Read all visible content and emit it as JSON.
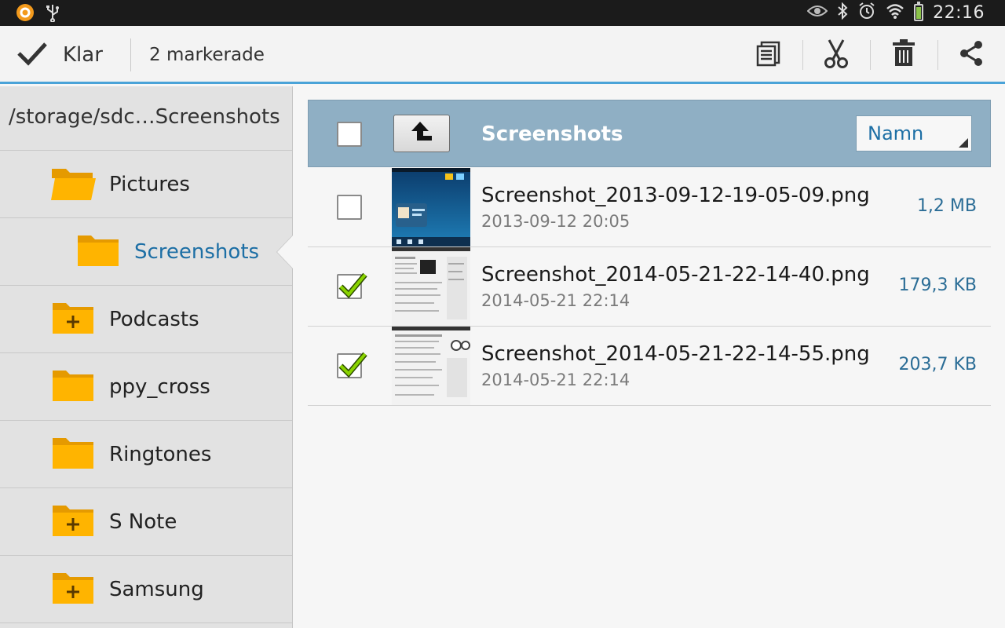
{
  "status_bar": {
    "time": "22:16"
  },
  "action_bar": {
    "done_label": "Klar",
    "selected_count": "2 markerade",
    "actions": [
      "select-all-icon",
      "cut-icon",
      "delete-icon",
      "share-icon"
    ]
  },
  "sidebar": {
    "path": "/storage/sdc…Screenshots",
    "folders": [
      {
        "label": "Pictures",
        "icon": "folder-open-icon"
      },
      {
        "label": "Screenshots",
        "icon": "folder-icon",
        "selected": true
      },
      {
        "label": "Podcasts",
        "icon": "folder-plus-icon"
      },
      {
        "label": "ppy_cross",
        "icon": "folder-icon"
      },
      {
        "label": "Ringtones",
        "icon": "folder-icon"
      },
      {
        "label": "S Note",
        "icon": "folder-plus-icon"
      },
      {
        "label": "Samsung",
        "icon": "folder-plus-icon"
      }
    ]
  },
  "list": {
    "header_title": "Screenshots",
    "sort_label": "Namn",
    "files": [
      {
        "name": "Screenshot_2013-09-12-19-05-09.png",
        "date": "2013-09-12 20:05",
        "size": "1,2 MB",
        "checked": false
      },
      {
        "name": "Screenshot_2014-05-21-22-14-40.png",
        "date": "2014-05-21 22:14",
        "size": "179,3 KB",
        "checked": true
      },
      {
        "name": "Screenshot_2014-05-21-22-14-55.png",
        "date": "2014-05-21 22:14",
        "size": "203,7 KB",
        "checked": true
      }
    ]
  },
  "colors": {
    "accent": "#4aa3d8",
    "header_bg": "#8fafc4",
    "folder": "#ffb400",
    "selected_text": "#1d6fa5",
    "check_green": "#7cc400"
  }
}
